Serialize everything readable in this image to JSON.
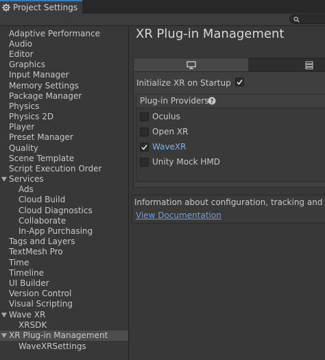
{
  "window": {
    "tab_title": "Project Settings"
  },
  "sidebar": {
    "items": [
      {
        "label": "Adaptive Performance"
      },
      {
        "label": "Audio"
      },
      {
        "label": "Editor"
      },
      {
        "label": "Graphics"
      },
      {
        "label": "Input Manager"
      },
      {
        "label": "Memory Settings"
      },
      {
        "label": "Package Manager"
      },
      {
        "label": "Physics"
      },
      {
        "label": "Physics 2D"
      },
      {
        "label": "Player"
      },
      {
        "label": "Preset Manager"
      },
      {
        "label": "Quality"
      },
      {
        "label": "Scene Template"
      },
      {
        "label": "Script Execution Order"
      },
      {
        "label": "Services"
      },
      {
        "label": "Ads"
      },
      {
        "label": "Cloud Build"
      },
      {
        "label": "Cloud Diagnostics"
      },
      {
        "label": "Collaborate"
      },
      {
        "label": "In-App Purchasing"
      },
      {
        "label": "Tags and Layers"
      },
      {
        "label": "TextMesh Pro"
      },
      {
        "label": "Time"
      },
      {
        "label": "Timeline"
      },
      {
        "label": "UI Builder"
      },
      {
        "label": "Version Control"
      },
      {
        "label": "Visual Scripting"
      },
      {
        "label": "Wave XR"
      },
      {
        "label": "XRSDK"
      },
      {
        "label": "XR Plug-in Management"
      },
      {
        "label": "WaveXRSettings"
      }
    ],
    "selected": "XR Plug-in Management"
  },
  "main": {
    "title": "XR Plug-in Management",
    "initialize_label": "Initialize XR on Startup",
    "initialize_checked": true,
    "providers_label": "Plug-in Providers",
    "providers": [
      {
        "label": "Oculus",
        "checked": false
      },
      {
        "label": "Open XR",
        "checked": false
      },
      {
        "label": "WaveXR",
        "checked": true
      },
      {
        "label": "Unity Mock HMD",
        "checked": false
      }
    ],
    "info_text": "Information about configuration, tracking and migration",
    "info_link": "View Documentation"
  },
  "icons": {
    "settings": "gear-icon",
    "search": "search-icon",
    "desktop_tab": "desktop-icon",
    "android_tab": "android-icon",
    "help": "help-icon",
    "dropdown": "triangle-down-icon"
  },
  "colors": {
    "accent": "#3a79bb",
    "link": "#6aa0e8",
    "selection": "#4d4d4d"
  }
}
